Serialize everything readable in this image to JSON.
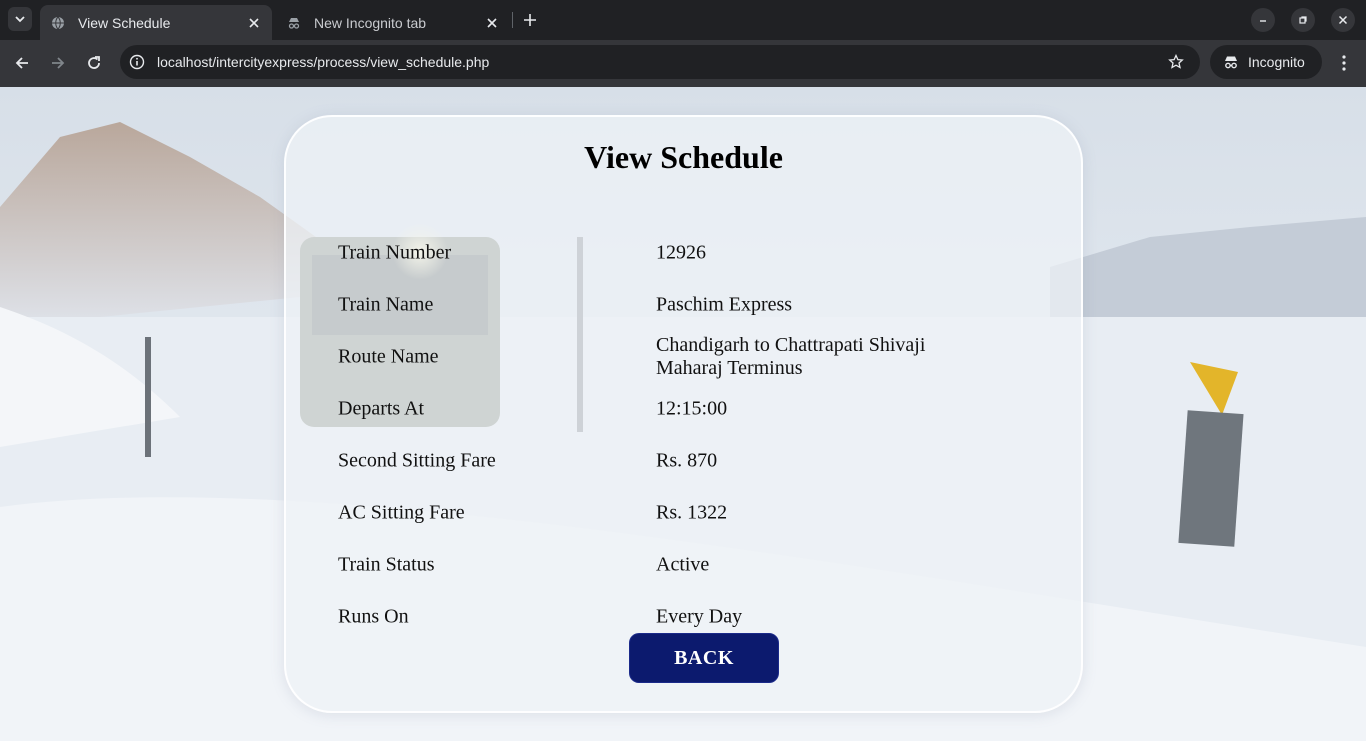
{
  "browser": {
    "tabs": [
      {
        "title": "View Schedule",
        "active": true,
        "icon": "globe-icon"
      },
      {
        "title": "New Incognito tab",
        "active": false,
        "icon": "incognito-icon"
      }
    ],
    "url": "localhost/intercityexpress/process/view_schedule.php",
    "profile_label": "Incognito"
  },
  "page": {
    "heading": "View Schedule",
    "rows": [
      {
        "label": "Train Number",
        "value": "12926"
      },
      {
        "label": "Train Name",
        "value": "Paschim Express"
      },
      {
        "label": "Route Name",
        "value": "Chandigarh to Chattrapati Shivaji Maharaj Terminus"
      },
      {
        "label": "Departs At",
        "value": "12:15:00"
      },
      {
        "label": "Second Sitting Fare",
        "value": "Rs. 870"
      },
      {
        "label": "AC Sitting Fare",
        "value": "Rs. 1322"
      },
      {
        "label": "Train Status",
        "value": "Active"
      },
      {
        "label": "Runs On",
        "value": "Every Day"
      }
    ],
    "back_label": "BACK"
  },
  "colors": {
    "button_bg": "#0c1a6e",
    "chrome_dark": "#202124",
    "chrome_toolbar": "#35363a"
  }
}
